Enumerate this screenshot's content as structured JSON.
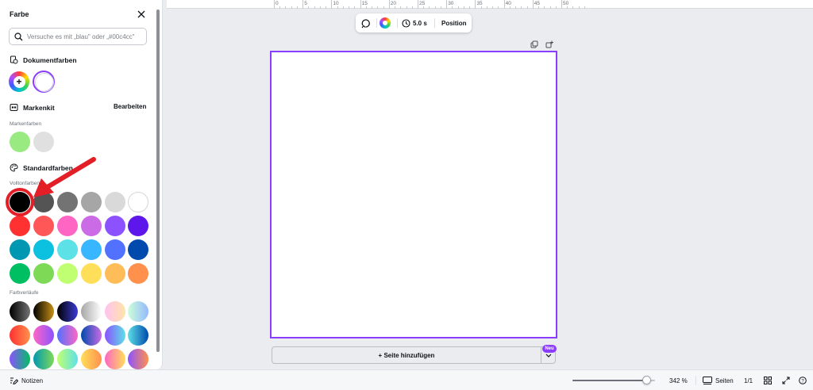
{
  "panel": {
    "title": "Farbe",
    "search_placeholder": "Versuche es mit „blau\" oder „#00c4cc\"",
    "document_colors": {
      "heading": "Dokumentfarben",
      "add_icon": "plus-icon",
      "colors": [
        "#ffffff"
      ]
    },
    "brand_kit": {
      "heading": "Markenkit",
      "edit_label": "Bearbeiten",
      "sublabel": "Markenfarben",
      "colors": [
        "#9aea82",
        "#e0e0e0"
      ]
    },
    "standard": {
      "heading": "Standardfarben",
      "solid_label": "Volltonfarben",
      "solid_rows": [
        [
          "#000000",
          "#545454",
          "#737373",
          "#a6a6a6",
          "#d9d9d9",
          "#ffffff"
        ],
        [
          "#ff3131",
          "#ff5757",
          "#ff66c4",
          "#cb6ce6",
          "#8c52ff",
          "#5e17eb"
        ],
        [
          "#0097b2",
          "#0cc0df",
          "#5ce1e6",
          "#38b6ff",
          "#5271ff",
          "#004aad"
        ],
        [
          "#00bf63",
          "#7ed957",
          "#c1ff72",
          "#ffde59",
          "#ffbd59",
          "#ff914d"
        ]
      ],
      "gradient_label": "Farbverläufe",
      "gradient_rows": [
        [
          [
            "#000000",
            "#737373"
          ],
          [
            "#000000",
            "#c89116"
          ],
          [
            "#000000",
            "#3b3bd6"
          ],
          [
            "#a6a6a6",
            "#ffffff"
          ],
          [
            "#ffc3f1",
            "#ffe3a7"
          ],
          [
            "#cdffd8",
            "#94b9ff"
          ]
        ],
        [
          [
            "#ff3131",
            "#ff914d"
          ],
          [
            "#ff66c4",
            "#8c52ff"
          ],
          [
            "#5170ff",
            "#ff66c4"
          ],
          [
            "#004aad",
            "#cb6ce6"
          ],
          [
            "#8c52ff",
            "#5ce1e6"
          ],
          [
            "#5de0e6",
            "#004aad"
          ]
        ],
        [
          [
            "#8c52ff",
            "#00bf63"
          ],
          [
            "#0097b2",
            "#7ed957"
          ],
          [
            "#c1ff72",
            "#5ce1e6"
          ],
          [
            "#ffde59",
            "#ff914d"
          ],
          [
            "#ff66c4",
            "#ffde59"
          ],
          [
            "#8c52ff",
            "#ff914d"
          ]
        ]
      ]
    }
  },
  "ruler": {
    "labels": [
      "0",
      "5",
      "10",
      "15",
      "20",
      "25",
      "30",
      "35",
      "40",
      "45",
      "50"
    ]
  },
  "toolbar": {
    "duration": "5.0 s",
    "position_label": "Position"
  },
  "add_page": {
    "label": "+ Seite hinzufügen",
    "badge": "Neu"
  },
  "statusbar": {
    "notes_label": "Notizen",
    "zoom": "342 %",
    "zoom_fraction": 0.9,
    "pages_label": "Seiten",
    "page_count": "1/1"
  },
  "annotation": {
    "color": "#e41e26"
  }
}
